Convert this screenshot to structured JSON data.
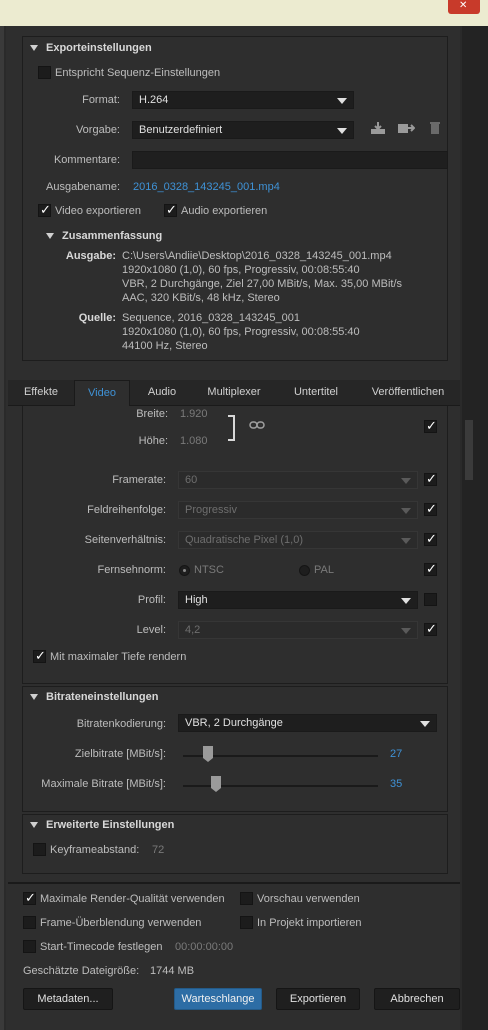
{
  "export_settings": {
    "title": "Exporteinstellungen",
    "match_sequence_label": "Entspricht Sequenz-Einstellungen",
    "format_label": "Format:",
    "format_value": "H.264",
    "preset_label": "Vorgabe:",
    "preset_value": "Benutzerdefiniert",
    "comment_label": "Kommentare:",
    "comment_value": "",
    "output_name_label": "Ausgabename:",
    "output_name_value": "2016_0328_143245_001.mp4",
    "export_video_label": "Video exportieren",
    "export_audio_label": "Audio exportieren"
  },
  "summary": {
    "title": "Zusammenfassung",
    "output_label": "Ausgabe:",
    "output_lines": [
      "C:\\Users\\Andiie\\Desktop\\2016_0328_143245_001.mp4",
      "1920x1080 (1,0), 60 fps, Progressiv, 00:08:55:40",
      "VBR, 2 Durchgänge, Ziel 27,00 MBit/s, Max. 35,00 MBit/s",
      "AAC, 320 KBit/s, 48 kHz, Stereo"
    ],
    "source_label": "Quelle:",
    "source_lines": [
      "Sequence, 2016_0328_143245_001",
      "1920x1080 (1,0), 60 fps, Progressiv, 00:08:55:40",
      "44100 Hz, Stereo"
    ]
  },
  "tabs": [
    "Effekte",
    "Video",
    "Audio",
    "Multiplexer",
    "Untertitel",
    "Veröffentlichen"
  ],
  "video": {
    "width_label": "Breite:",
    "width_value": "1.920",
    "height_label": "Höhe:",
    "height_value": "1.080",
    "framerate_label": "Framerate:",
    "framerate_value": "60",
    "field_order_label": "Feldreihenfolge:",
    "field_order_value": "Progressiv",
    "aspect_label": "Seitenverhältnis:",
    "aspect_value": "Quadratische Pixel (1,0)",
    "tv_standard_label": "Fernsehnorm:",
    "tv_ntsc": "NTSC",
    "tv_pal": "PAL",
    "profile_label": "Profil:",
    "profile_value": "High",
    "level_label": "Level:",
    "level_value": "4,2",
    "max_depth_label": "Mit maximaler Tiefe rendern"
  },
  "bitrate": {
    "title": "Bitrateneinstellungen",
    "encoding_label": "Bitratenkodierung:",
    "encoding_value": "VBR, 2 Durchgänge",
    "target_label": "Zielbitrate [MBit/s]:",
    "target_value": "27",
    "target_fraction": 0.13,
    "max_label": "Maximale Bitrate [MBit/s]:",
    "max_value": "35",
    "max_fraction": 0.17
  },
  "advanced": {
    "title": "Erweiterte Einstellungen",
    "keyframe_label": "Keyframeabstand:",
    "keyframe_value": "72"
  },
  "bottom": {
    "max_render_quality": "Maximale Render-Qualität verwenden",
    "use_previews": "Vorschau verwenden",
    "frame_blending": "Frame-Überblendung verwenden",
    "import_project": "In Projekt importieren",
    "start_timecode": "Start-Timecode festlegen",
    "start_timecode_value": "00:00:00:00",
    "file_size_label": "Geschätzte Dateigröße:",
    "file_size_value": "1744 MB",
    "metadata_button": "Metadaten...",
    "queue_button": "Warteschlange",
    "export_button": "Exportieren",
    "cancel_button": "Abbrechen"
  },
  "colors": {
    "accent": "#3f92d6",
    "primary_button": "#2d6da5"
  }
}
